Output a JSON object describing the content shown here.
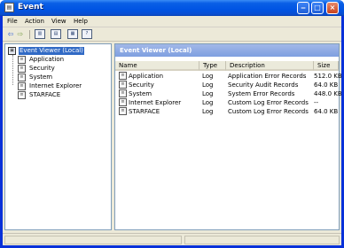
{
  "window": {
    "title": "Event"
  },
  "menu": [
    "File",
    "Action",
    "View",
    "Help"
  ],
  "tree": {
    "root": "Event Viewer (Local)",
    "items": [
      "Application",
      "Security",
      "System",
      "Internet Explorer",
      "STARFACE"
    ]
  },
  "pane": {
    "header": "Event Viewer (Local)",
    "columns": [
      "Name",
      "Type",
      "Description",
      "Size"
    ],
    "rows": [
      {
        "name": "Application",
        "type": "Log",
        "description": "Application Error Records",
        "size": "512.0 KB"
      },
      {
        "name": "Security",
        "type": "Log",
        "description": "Security Audit Records",
        "size": "64.0 KB"
      },
      {
        "name": "System",
        "type": "Log",
        "description": "System Error Records",
        "size": "448.0 KB"
      },
      {
        "name": "Internet Explorer",
        "type": "Log",
        "description": "Custom Log Error Records",
        "size": "--"
      },
      {
        "name": "STARFACE",
        "type": "Log",
        "description": "Custom Log Error Records",
        "size": "64.0 KB"
      }
    ]
  },
  "icons": {
    "back": "back-arrow-icon",
    "forward": "forward-arrow-icon",
    "tool1": "show-hide-console-tree-icon",
    "tool2": "properties-icon",
    "tool3": "export-list-icon",
    "tool4": "help-icon"
  }
}
